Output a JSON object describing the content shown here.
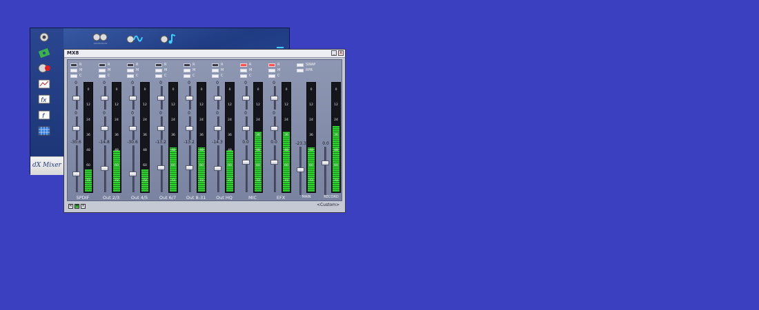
{
  "launcher": {
    "footer_text": "dX Mixer",
    "top_icons": [
      "speakers-icon",
      "mixer-icon",
      "wave-icon",
      "music-note-icon"
    ],
    "side_icons": [
      "speaker-icon",
      "patch-icon",
      "record-icon",
      "graph-icon",
      "fx-icon",
      "function-icon",
      "grid-icon"
    ]
  },
  "window": {
    "title": "MX8",
    "minimize": "_",
    "close": "x",
    "preset": "<Custom>",
    "bottom_buttons": [
      "R",
      "M",
      "X"
    ]
  },
  "labels": {
    "r": "R",
    "m": "M",
    "c": "C",
    "swap": "SWAP",
    "rpr": "RPR"
  },
  "meter_ticks": [
    "0",
    "12",
    "24",
    "36",
    "48",
    "60",
    "72"
  ],
  "channels": [
    {
      "name": "SPDIF",
      "top_vals": [
        "0",
        "0"
      ],
      "bottom_val": "-30.6",
      "r_red": false,
      "level": 0.2
    },
    {
      "name": "Out 2/3",
      "top_vals": [
        "0",
        "0"
      ],
      "bottom_val": "-14.8",
      "r_red": false,
      "level": 0.38
    },
    {
      "name": "Out 4/5",
      "top_vals": [
        "0",
        "0"
      ],
      "bottom_val": "-30.6",
      "r_red": false,
      "level": 0.2
    },
    {
      "name": "Out 6/7",
      "top_vals": [
        "0",
        "0"
      ],
      "bottom_val": "-13.2",
      "r_red": false,
      "level": 0.4
    },
    {
      "name": "Out 8-31",
      "top_vals": [
        "0",
        "0"
      ],
      "bottom_val": "-13.2",
      "r_red": false,
      "level": 0.4
    },
    {
      "name": "Out HQ",
      "top_vals": [
        "0",
        "0"
      ],
      "bottom_val": "-14.3",
      "r_red": false,
      "level": 0.38
    },
    {
      "name": "MIC",
      "top_vals": [
        "0",
        "0"
      ],
      "bottom_val": "0.0",
      "r_red": true,
      "level": 0.55
    },
    {
      "name": "EFX",
      "top_vals": [
        "0",
        "0"
      ],
      "bottom_val": "0.0",
      "r_red": true,
      "level": 0.55
    }
  ],
  "main": {
    "name": "MAIN",
    "val": "-23.3",
    "level": 0.4
  },
  "record": {
    "name": "RECORD",
    "val": "0.0",
    "level": 0.6
  }
}
